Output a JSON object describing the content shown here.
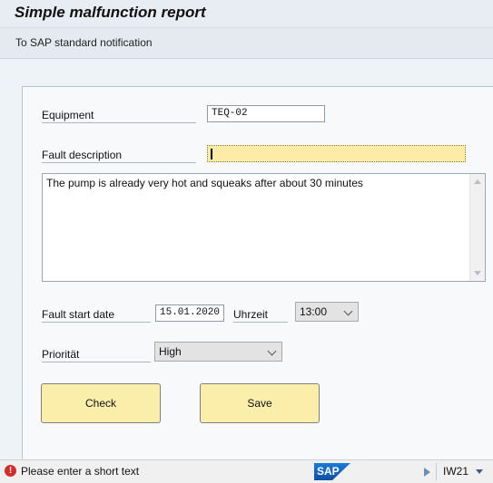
{
  "window": {
    "title": "Simple malfunction report"
  },
  "toolbar": {
    "link_label": "To SAP standard notification"
  },
  "form": {
    "equipment": {
      "label": "Equipment",
      "value": "TEQ-02"
    },
    "fault_description": {
      "label": "Fault description",
      "value": ""
    },
    "long_text": {
      "value": "The pump is already very hot and squeaks after about 30 minutes"
    },
    "fault_start_date": {
      "label": "Fault start date",
      "value": "15.01.2020"
    },
    "time": {
      "label": "Uhrzeit",
      "value": "13:00"
    },
    "priority": {
      "label": "Priorität",
      "value": "High"
    }
  },
  "buttons": {
    "check_label": "Check",
    "save_label": "Save"
  },
  "status_bar": {
    "message": "Please enter a short text",
    "message_type": "error",
    "logo_text": "SAP",
    "transaction_code": "IW21"
  },
  "colors": {
    "button_fill": "#fbeeab",
    "focused_field": "#fdeba8",
    "error_icon": "#d42b2b",
    "sap_blue": "#0b4fa3"
  }
}
